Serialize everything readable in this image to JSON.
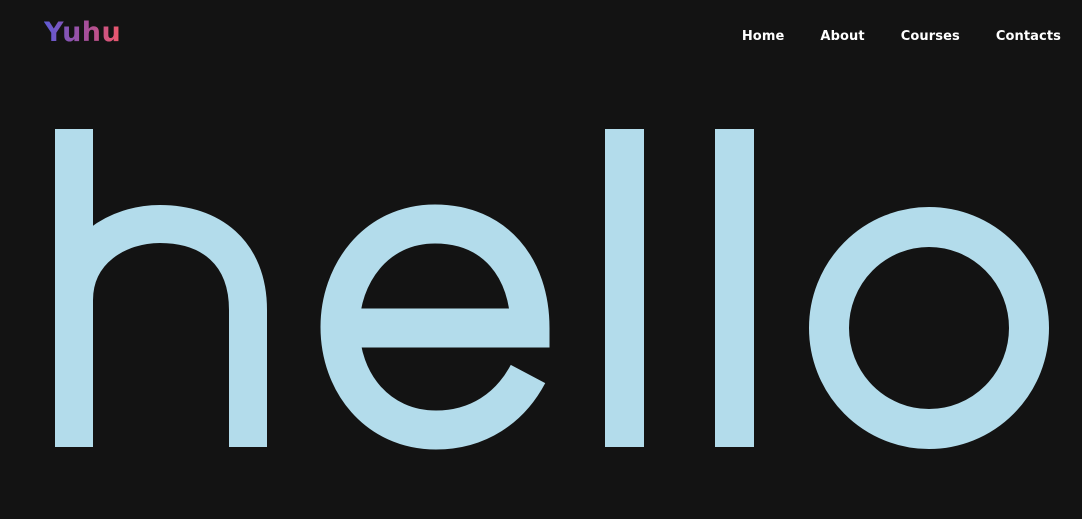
{
  "brand": {
    "name": "Yuhu",
    "gradient_start": "#5f5bd6",
    "gradient_end": "#f0586a"
  },
  "nav": {
    "items": [
      {
        "label": "Home"
      },
      {
        "label": "About"
      },
      {
        "label": "Courses"
      },
      {
        "label": "Contacts"
      }
    ]
  },
  "hero": {
    "word": "hello",
    "color": "#b3dceb",
    "background": "#131313"
  }
}
